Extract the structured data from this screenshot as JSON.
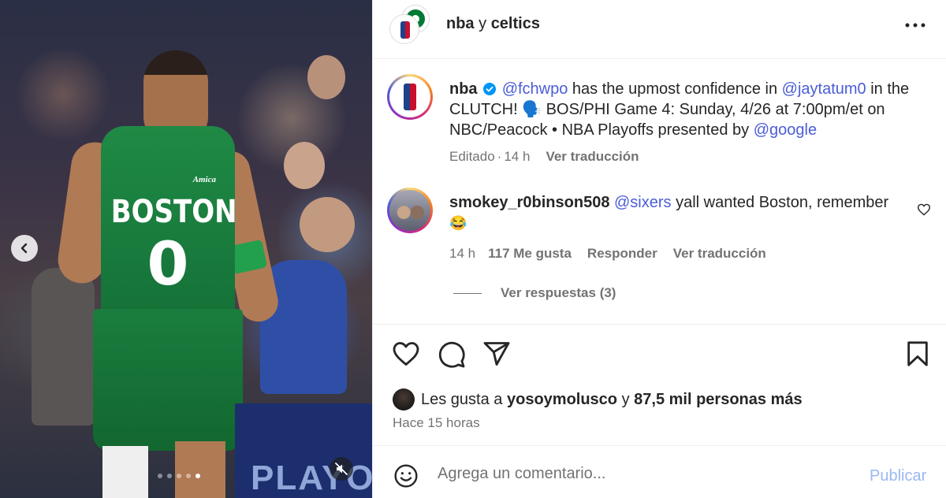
{
  "header": {
    "account_1": "nba",
    "separator": "y",
    "account_2": "celtics"
  },
  "media": {
    "jersey_top": "Amica",
    "jersey_team": "BOSTON",
    "jersey_number": "0",
    "banner_text": "PLAYOFF",
    "carousel_total": 5,
    "carousel_active": 5
  },
  "caption": {
    "username": "nba",
    "mention_1": "@fchwpo",
    "text_1": " has the upmost confidence in ",
    "mention_2": "@jaytatum0",
    "text_2": " in the CLUTCH! 🗣️ BOS/PHI Game 4: Sunday, 4/26 at 7:00pm/et on NBC/Peacock • NBA Playoffs presented by ",
    "mention_3": "@google",
    "edited": "Editado",
    "dot": "·",
    "time": "14 h",
    "translate": "Ver traducción"
  },
  "comment": {
    "username": "smokey_r0binson508",
    "mention": "@sixers",
    "text": " yall wanted Boston, remember",
    "emoji": "😂",
    "time": "14 h",
    "likes": "117 Me gusta",
    "reply": "Responder",
    "translate": "Ver traducción",
    "view_replies": "Ver respuestas (3)"
  },
  "likes": {
    "prefix": "Les gusta a ",
    "user": "yosoymolusco",
    "middle": " y ",
    "count": "87,5 mil personas más"
  },
  "posted": "Hace 15 horas",
  "add_comment": {
    "placeholder": "Agrega un comentario...",
    "publish": "Publicar"
  },
  "colors": {
    "mention": "#4a5dd8",
    "publish_disabled": "#9bb7f5",
    "verified": "#0095f6",
    "jersey_green": "#1f8a45"
  }
}
